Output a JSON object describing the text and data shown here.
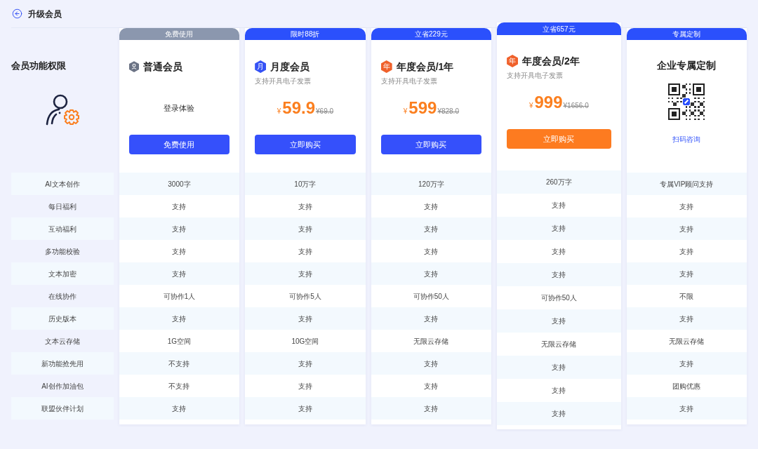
{
  "header": {
    "title": "升级会员"
  },
  "features": {
    "title": "会员功能权限",
    "labels": [
      "AI文本创作",
      "每日福利",
      "互动福利",
      "多功能校验",
      "文本加密",
      "在线协作",
      "历史版本",
      "文本云存储",
      "新功能抢先用",
      "AI创作加油包",
      "联盟伙伴计划"
    ]
  },
  "plans": [
    {
      "kind": "free",
      "featured": false,
      "ribbon": {
        "text": "免费使用",
        "color": "#8b97ae"
      },
      "badge": {
        "kind": "icon",
        "color": "#6b7385"
      },
      "title": "普通会员",
      "note": "登录体验",
      "button": {
        "label": "免费使用"
      },
      "values": [
        "3000字",
        "支持",
        "支持",
        "支持",
        "支持",
        "可协作1人",
        "支持",
        "1G空间",
        "不支持",
        "不支持",
        "支持"
      ]
    },
    {
      "kind": "paid",
      "featured": false,
      "ribbon": {
        "text": "限时88折",
        "color": "#2b50fc"
      },
      "badge": {
        "kind": "text",
        "text": "月",
        "color": "#3552f5"
      },
      "title": "月度会员",
      "subtitle": "支持开具电子发票",
      "price": {
        "currency": "¥",
        "amount": "59.9",
        "original": "¥69.0"
      },
      "button": {
        "label": "立即购买"
      },
      "values": [
        "10万字",
        "支持",
        "支持",
        "支持",
        "支持",
        "可协作5人",
        "支持",
        "10G空间",
        "支持",
        "支持",
        "支持"
      ]
    },
    {
      "kind": "paid",
      "featured": false,
      "ribbon": {
        "text": "立省229元",
        "color": "#2b50fc"
      },
      "badge": {
        "kind": "text",
        "text": "年",
        "color": "#f0612b"
      },
      "title": "年度会员/1年",
      "subtitle": "支持开具电子发票",
      "price": {
        "currency": "¥",
        "amount": "599",
        "original": "¥828.0"
      },
      "button": {
        "label": "立即购买"
      },
      "values": [
        "120万字",
        "支持",
        "支持",
        "支持",
        "支持",
        "可协作50人",
        "支持",
        "无限云存储",
        "支持",
        "支持",
        "支持"
      ]
    },
    {
      "kind": "paid",
      "featured": true,
      "ribbon": {
        "text": "立省657元",
        "color": "#2b50fc"
      },
      "badge": {
        "kind": "text",
        "text": "年",
        "color": "#f0612b"
      },
      "title": "年度会员/2年",
      "subtitle": "支持开具电子发票",
      "price": {
        "currency": "¥",
        "amount": "999",
        "original": "¥1656.0"
      },
      "button": {
        "label": "立即购买"
      },
      "values": [
        "260万字",
        "支持",
        "支持",
        "支持",
        "支持",
        "可协作50人",
        "支持",
        "无限云存储",
        "支持",
        "支持",
        "支持"
      ]
    },
    {
      "kind": "enterprise",
      "featured": false,
      "ribbon": {
        "text": "专属定制",
        "color": "#2b50fc"
      },
      "title": "企业专属定制",
      "link": "扫码咨询",
      "values": [
        "专属VIP顾问支持",
        "支持",
        "支持",
        "支持",
        "支持",
        "不限",
        "支持",
        "无限云存储",
        "支持",
        "团购优惠",
        "支持"
      ]
    }
  ]
}
